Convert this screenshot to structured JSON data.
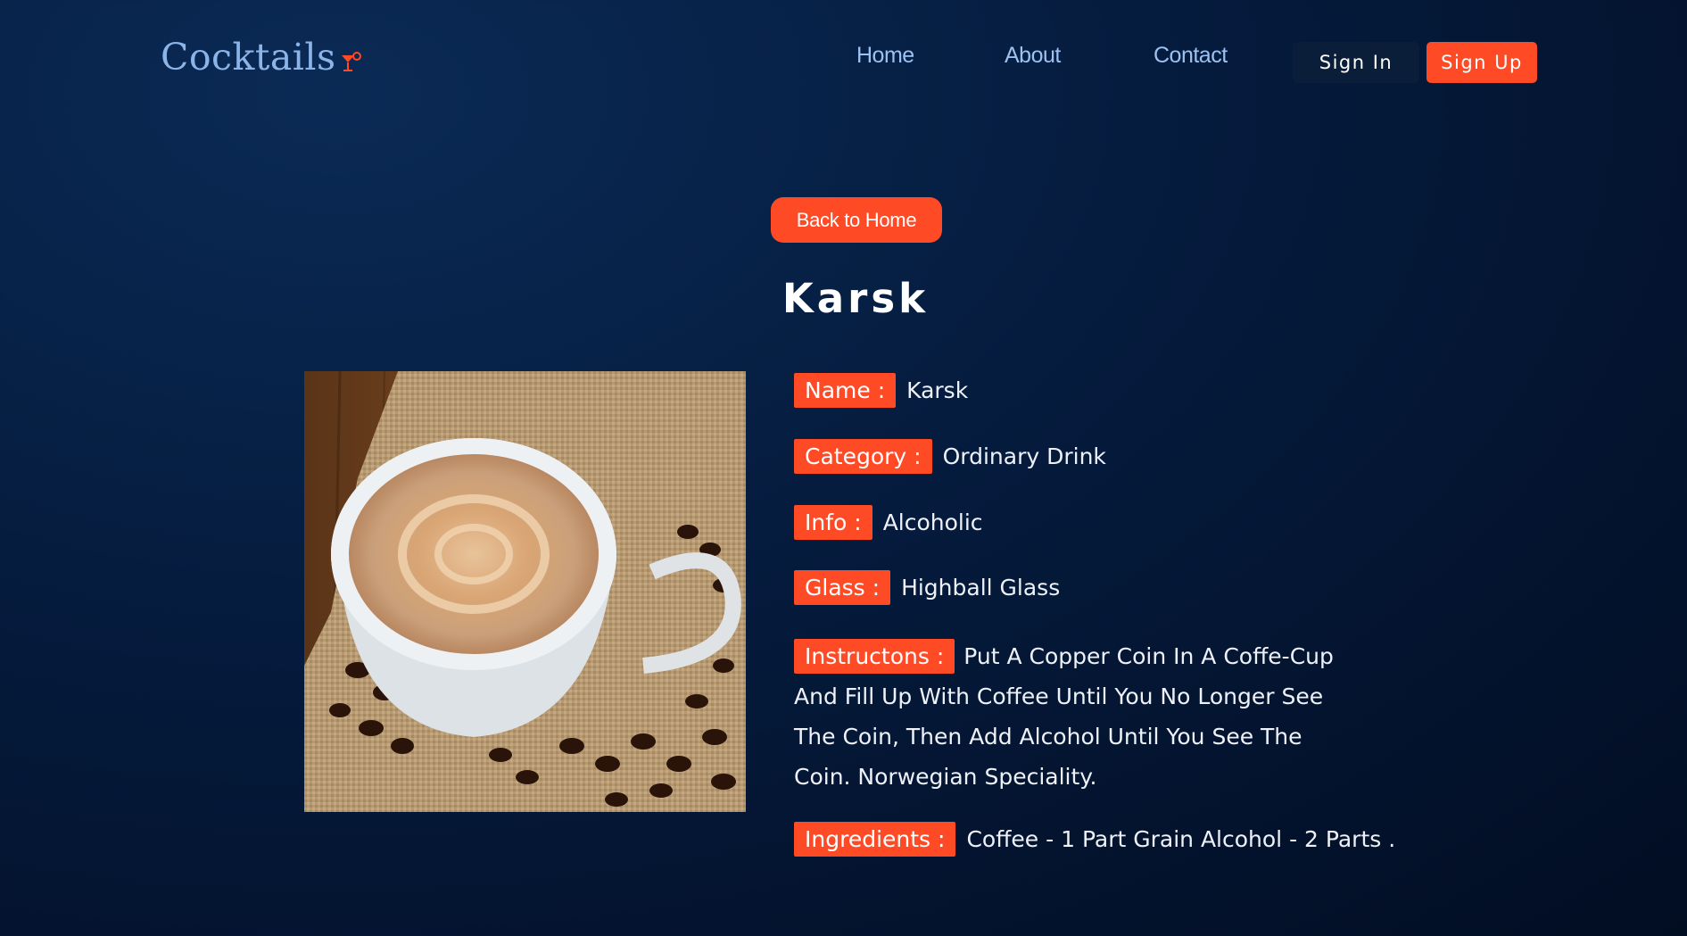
{
  "header": {
    "logo_text": "Cocktails",
    "logo_icon": "cocktail-glass-icon",
    "nav": {
      "home": "Home",
      "about": "About",
      "contact": "Contact"
    },
    "sign_in": "Sign In",
    "sign_up": "Sign Up"
  },
  "main": {
    "back_button": "Back to Home",
    "title": "Karsk",
    "image_subject": "coffee cup with coffee beans",
    "details": {
      "name_label": "Name :",
      "name_value": "Karsk",
      "category_label": "Category :",
      "category_value": "Ordinary Drink",
      "info_label": "Info :",
      "info_value": "Alcoholic",
      "glass_label": "Glass :",
      "glass_value": "Highball Glass",
      "instructions_label": "Instructons :",
      "instructions_value": "Put A Copper Coin In A Coffe-Cup And Fill Up With Coffee Until You No Longer See The Coin, Then Add Alcohol Until You See The Coin. Norwegian Speciality.",
      "ingredients_label": "Ingredients :",
      "ingredients_value": "Coffee - 1 Part Grain Alcohol - 2 Parts ."
    }
  },
  "colors": {
    "accent": "#ff4a26",
    "background": "#051b3d",
    "nav_link": "#9cc2f2",
    "logo": "#8bb4e8"
  }
}
